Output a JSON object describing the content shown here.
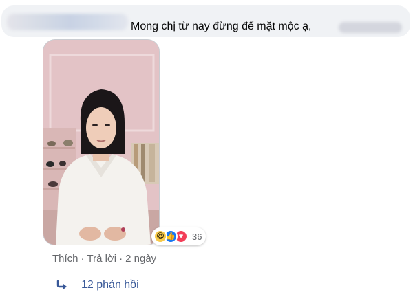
{
  "comment": {
    "text": "Mong chị từ nay đừng để mặt mộc ạ,",
    "photo_alt": "photo"
  },
  "reactions": {
    "icons": [
      "haha-icon",
      "like-icon",
      "love-icon"
    ],
    "count": "36",
    "colors": {
      "haha": "#f7c948",
      "like": "#1877f2",
      "love": "#f33e58"
    }
  },
  "actions": {
    "like": "Thích",
    "reply": "Trả lời",
    "time": "2 ngày",
    "separator": "·"
  },
  "replies": {
    "label": "12 phản hồi",
    "icon": "reply-arrow-icon",
    "color": "#385898"
  }
}
